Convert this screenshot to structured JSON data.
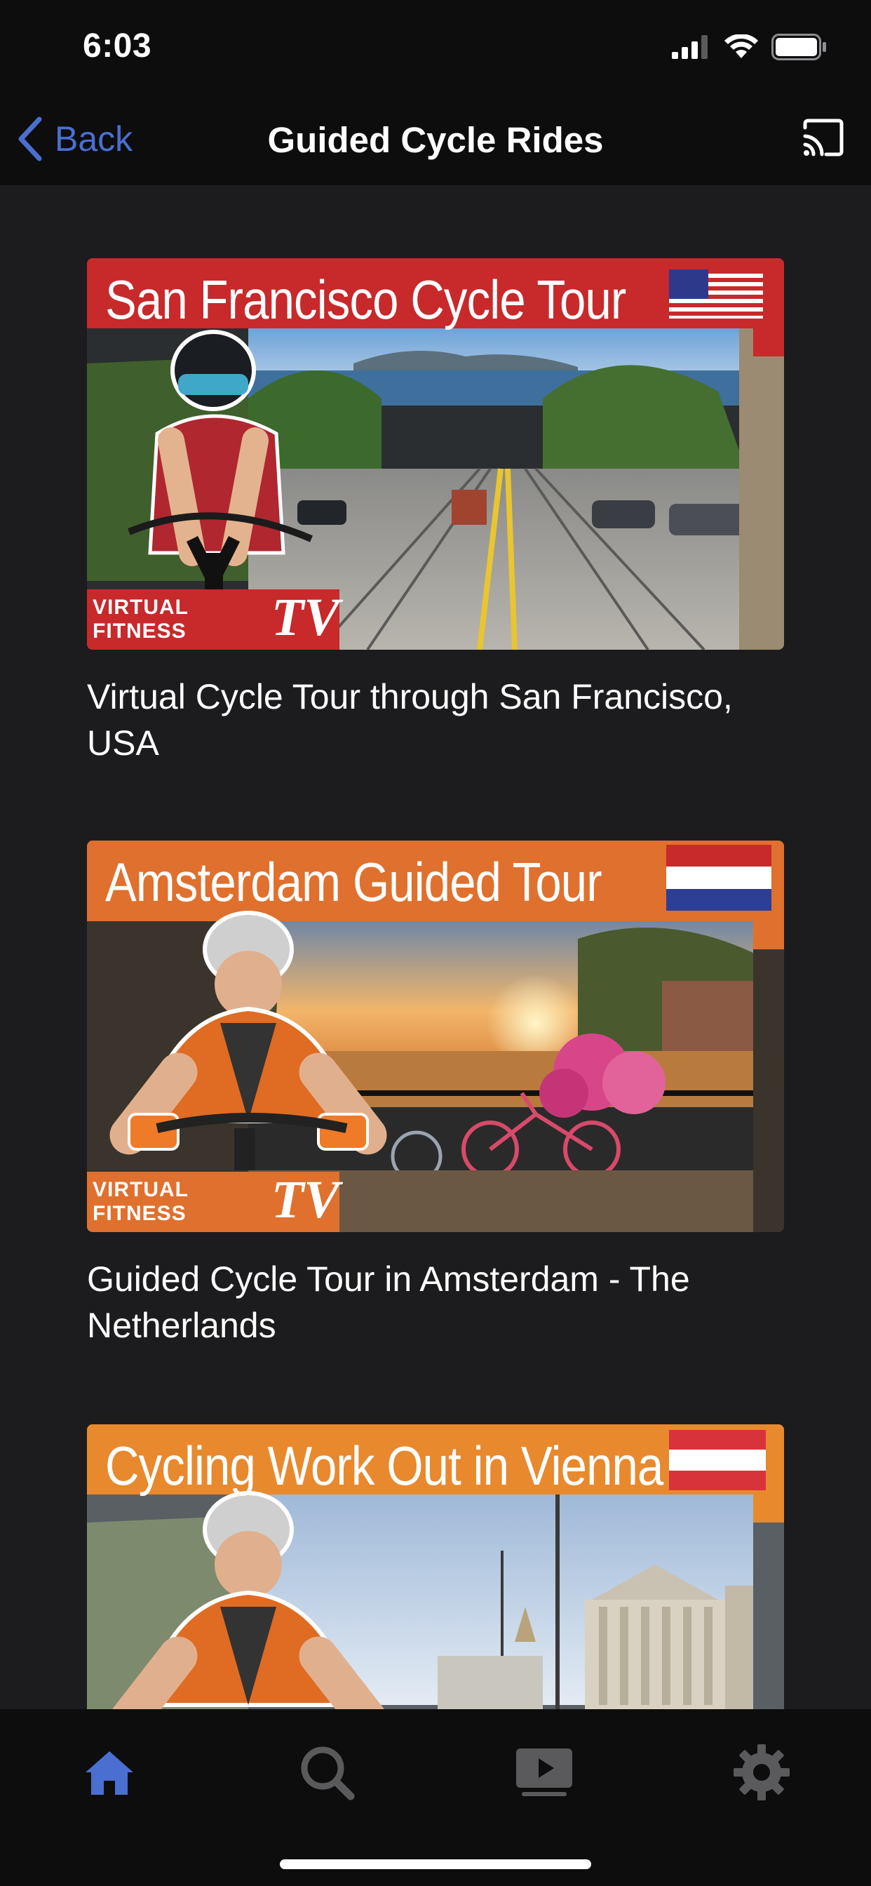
{
  "status_bar": {
    "time": "6:03",
    "icons": [
      "cellular-signal-icon",
      "wifi-icon",
      "battery-icon"
    ]
  },
  "nav": {
    "back_label": "Back",
    "title": "Guided Cycle Rides",
    "cast_icon": "cast-icon"
  },
  "brand": {
    "badge_text": "VIRTUAL FITNESS",
    "badge_tv": "TV",
    "accent_color": "#4a6fd0"
  },
  "rides": [
    {
      "thumb_title": "San Francisco Cycle Tour",
      "description": "Virtual Cycle Tour through San Francisco, USA",
      "banner_color": "#c8292b",
      "flag": "usa-flag-icon"
    },
    {
      "thumb_title": "Amsterdam Guided Tour",
      "description": "Guided Cycle Tour in Amsterdam - The Netherlands",
      "banner_color": "#e0702e",
      "flag": "netherlands-flag-icon"
    },
    {
      "thumb_title": "Cycling Work Out in Vienna",
      "description": "",
      "banner_color": "#e8892e",
      "flag": "austria-flag-icon"
    }
  ],
  "tab_bar": {
    "tabs": [
      {
        "icon": "home-icon",
        "active": true
      },
      {
        "icon": "search-icon",
        "active": false
      },
      {
        "icon": "video-library-icon",
        "active": false
      },
      {
        "icon": "settings-gear-icon",
        "active": false
      }
    ],
    "active_color": "#4a6fd0",
    "inactive_color": "#5a5a5c"
  }
}
